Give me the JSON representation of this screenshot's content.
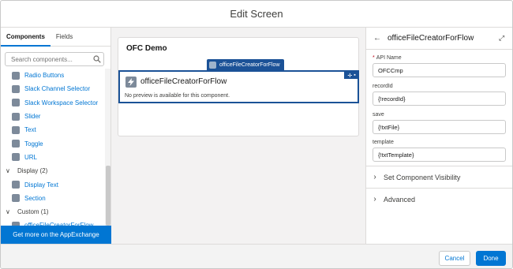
{
  "header": {
    "title": "Edit Screen"
  },
  "left_panel": {
    "tabs": [
      {
        "label": "Components",
        "active": true
      },
      {
        "label": "Fields",
        "active": false
      }
    ],
    "search": {
      "placeholder": "Search components...",
      "icon": "search-icon"
    },
    "items": [
      {
        "kind": "item",
        "label": "Radio Buttons",
        "icon": "radio-icon"
      },
      {
        "kind": "item",
        "label": "Slack Channel Selector",
        "icon": "slack-icon"
      },
      {
        "kind": "item",
        "label": "Slack Workspace Selector",
        "icon": "slack-icon"
      },
      {
        "kind": "item",
        "label": "Slider",
        "icon": "slider-icon"
      },
      {
        "kind": "item",
        "label": "Text",
        "icon": "text-icon"
      },
      {
        "kind": "item",
        "label": "Toggle",
        "icon": "toggle-icon"
      },
      {
        "kind": "item",
        "label": "URL",
        "icon": "link-icon"
      },
      {
        "kind": "group",
        "label": "Display (2)"
      },
      {
        "kind": "item",
        "label": "Display Text",
        "icon": "display-text-icon"
      },
      {
        "kind": "item",
        "label": "Section",
        "icon": "section-icon"
      },
      {
        "kind": "group",
        "label": "Custom (1)"
      },
      {
        "kind": "item",
        "label": "officeFileCreatorForFlow",
        "icon": "lightning-icon"
      }
    ],
    "appexchange_label": "Get more on the AppExchange"
  },
  "canvas": {
    "screen_title": "OFC Demo",
    "component_tag": "officeFileCreatorForFlow",
    "component_name": "officeFileCreatorForFlow",
    "component_note": "No preview is available for this component."
  },
  "right_panel": {
    "title": "officeFileCreatorForFlow",
    "fields": [
      {
        "label": "API Name",
        "required": true,
        "value": "OFCCmp"
      },
      {
        "label": "recordId",
        "required": false,
        "value": "{!recordId}"
      },
      {
        "label": "save",
        "required": false,
        "value": "{!txtFile}"
      },
      {
        "label": "template",
        "required": false,
        "value": "{!txtTemplate}"
      }
    ],
    "sections": [
      {
        "label": "Set Component Visibility"
      },
      {
        "label": "Advanced"
      }
    ]
  },
  "footer": {
    "cancel_label": "Cancel",
    "done_label": "Done"
  },
  "colors": {
    "brand": "#0176d3",
    "selection": "#1b5297",
    "required": "#ba0517"
  }
}
